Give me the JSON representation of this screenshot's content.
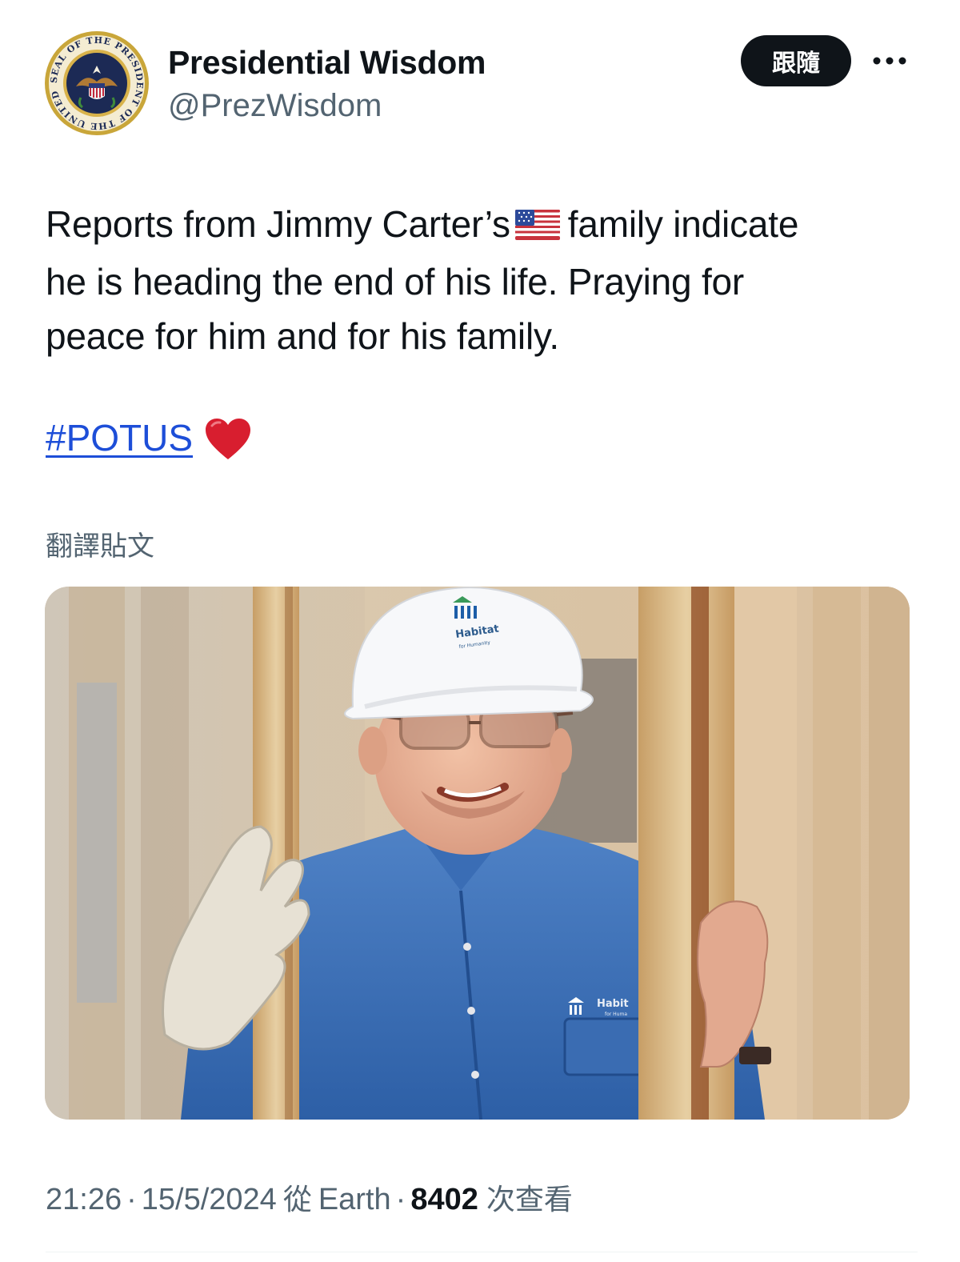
{
  "account": {
    "display_name": "Presidential Wisdom",
    "handle": "@PrezWisdom",
    "avatar_icon": "presidential-seal-icon",
    "seal_text": "SEAL OF THE PRESIDENT OF THE UNITED STATES"
  },
  "actions": {
    "follow_label": "跟隨",
    "more_icon": "more-dots-icon"
  },
  "tweet": {
    "line1_before": "Reports from Jimmy Carter’s",
    "flag_icon": "us-flag-emoji",
    "line1_after": "family indicate",
    "line2": "he is heading the end of his life.  Praying for",
    "line3": "peace for him and for his family.",
    "hashtag": "#POTUS",
    "heart_icon": "red-heart-emoji",
    "translate_label": "翻譯貼文"
  },
  "media": {
    "hardhat_logo_text": "Habitat",
    "hardhat_logo_subtext": "for Humanity",
    "shirt_logo_text": "Habit",
    "shirt_logo_subtext": "for Huma"
  },
  "meta": {
    "time": "21:26",
    "dot1": "·",
    "date": "15/5/2024",
    "from_label": "從",
    "source": "Earth",
    "dot2": "·",
    "views_count": "8402",
    "views_label": "次查看"
  },
  "colors": {
    "follow_bg": "#0f1419",
    "hashtag": "#1d4ed8",
    "secondary_text": "#536471"
  }
}
